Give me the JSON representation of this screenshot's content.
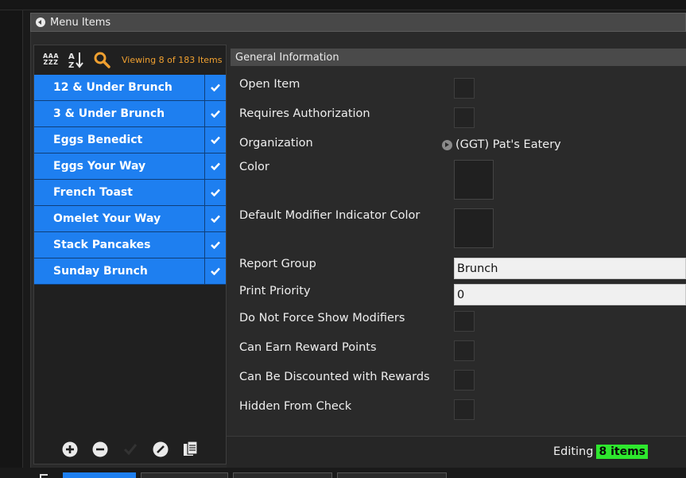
{
  "panel": {
    "title": "Menu Items"
  },
  "list": {
    "viewing": "Viewing 8 of 183 Items",
    "items": [
      {
        "label": "12 & Under Brunch"
      },
      {
        "label": "3 & Under Brunch"
      },
      {
        "label": "Eggs Benedict"
      },
      {
        "label": "Eggs Your Way"
      },
      {
        "label": "French Toast"
      },
      {
        "label": "Omelet Your Way"
      },
      {
        "label": "Stack Pancakes"
      },
      {
        "label": "Sunday Brunch"
      }
    ],
    "toolbar": {
      "sort_aaa_line1": "AAA",
      "sort_aaa_line2": "ZZZ"
    }
  },
  "details": {
    "section_title": "General Information",
    "fields": {
      "open_item": "Open Item",
      "requires_authorization": "Requires Authorization",
      "organization": "Organization",
      "organization_value": "(GGT) Pat's Eatery",
      "color": "Color",
      "default_modifier_indicator_color": "Default Modifier Indicator Color",
      "report_group": "Report Group",
      "report_group_value": "Brunch",
      "print_priority": "Print Priority",
      "print_priority_value": "0",
      "do_not_force_show_modifiers": "Do Not Force Show Modifiers",
      "can_earn_reward_points": "Can Earn Reward Points",
      "can_be_discounted_with_rewards": "Can Be Discounted with Rewards",
      "hidden_from_check": "Hidden From Check"
    }
  },
  "status": {
    "editing_label": "Editing",
    "editing_count": "8 items"
  },
  "colors": {
    "accent": "#1e7ff0",
    "highlight": "#f0a030",
    "badge": "#2ee82e"
  },
  "icons": [
    "sort-alpha-icon",
    "sort-az-icon",
    "search-icon",
    "check-icon",
    "add-icon",
    "remove-icon",
    "edit-icon",
    "copy-icon",
    "collapse-icon",
    "arrow-icon"
  ]
}
